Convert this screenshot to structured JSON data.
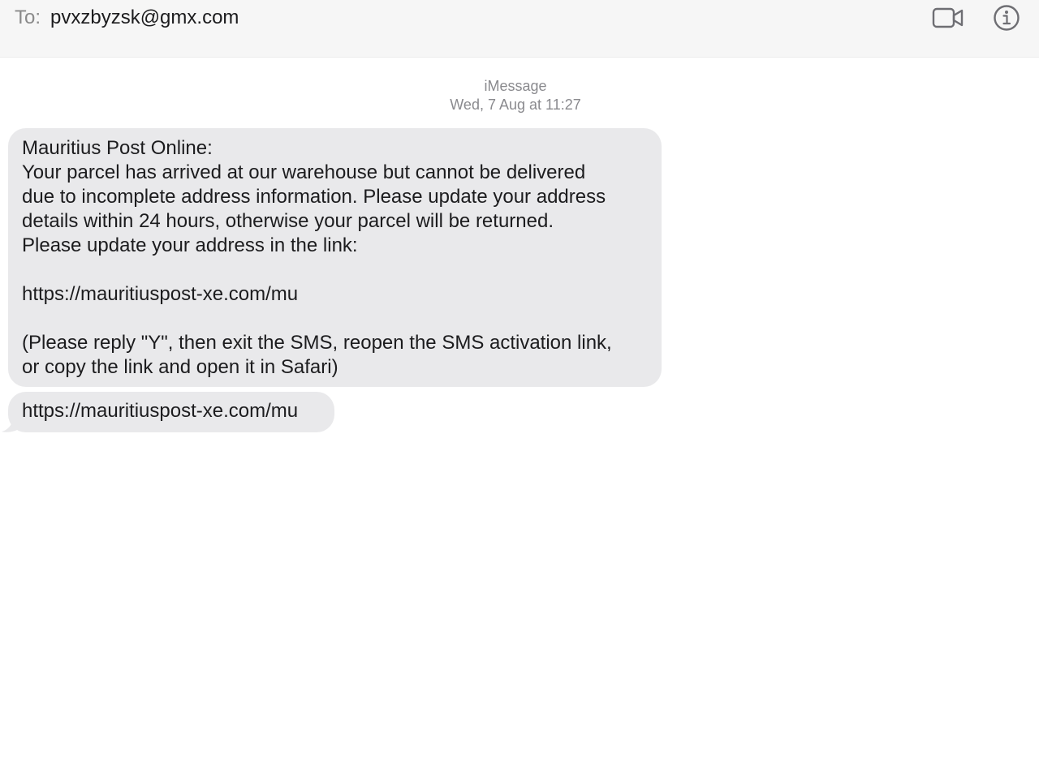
{
  "header": {
    "to_label": "To:",
    "to_value": "pvxzbyzsk@gmx.com",
    "video_icon": "video-camera-icon",
    "info_icon": "info-icon"
  },
  "conversation": {
    "service": "iMessage",
    "timestamp": "Wed, 7 Aug at 11:27",
    "messages": [
      {
        "text": "Mauritius Post Online:\nYour parcel has arrived at our warehouse but cannot be delivered\ndue to incomplete address information. Please update your address\ndetails within 24 hours, otherwise your parcel will be returned.\nPlease update your address in the link:\n\nhttps://mauritiuspost-xe.com/mu\n\n(Please reply \"Y\", then exit the SMS, reopen the SMS activation link,\nor copy the link and open it in Safari)"
      },
      {
        "text": "https://mauritiuspost-xe.com/mu"
      }
    ]
  },
  "colors": {
    "header_bg": "#f6f6f6",
    "bubble_bg": "#e9e9eb",
    "meta_text": "#8a8a8e",
    "icon_stroke": "#6e6e73"
  }
}
